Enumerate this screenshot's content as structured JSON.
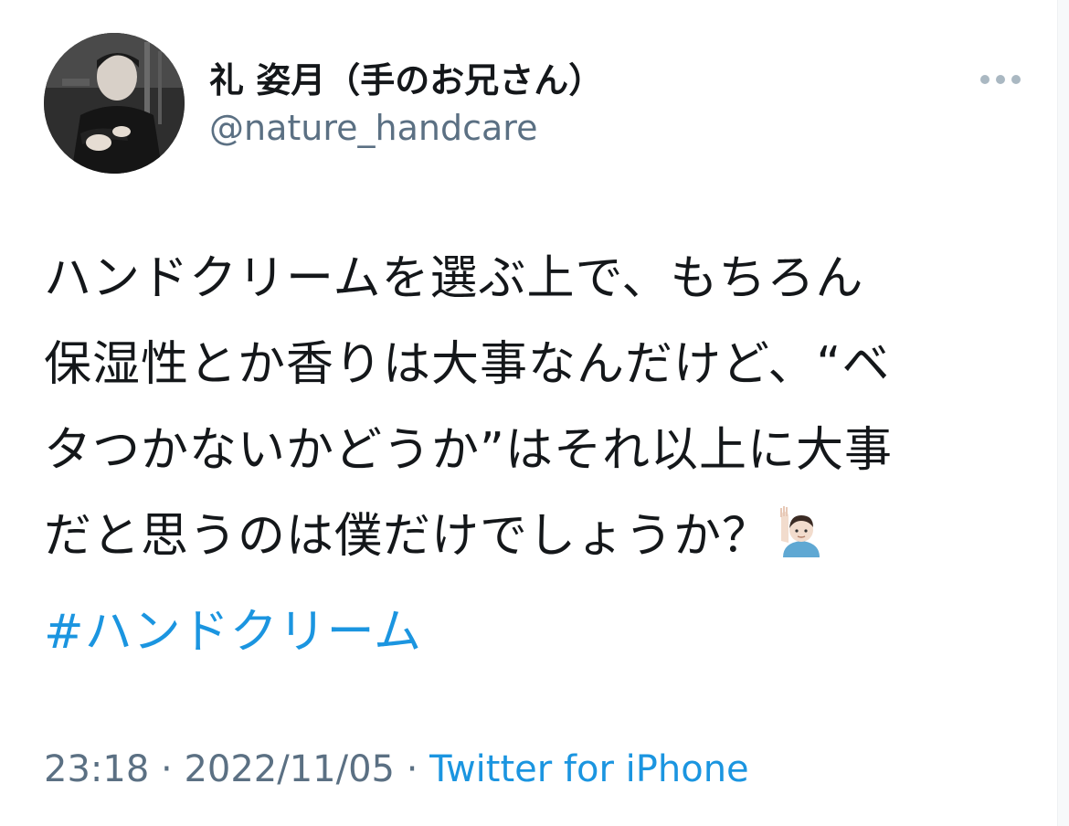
{
  "user": {
    "display_name": "礼 姿月（手のお兄さん）",
    "handle": "@nature_handcare"
  },
  "tweet": {
    "lines": [
      "ハンドクリームを選ぶ上で、もちろん",
      "保湿性とか香りは大事なんだけど、“ベ",
      "タつかないかどうか”はそれ以上に大事",
      "だと思うのは僕だけでしょうか？"
    ],
    "emoji": "raising-hand-emoji",
    "hashtag": "#ハンドクリーム"
  },
  "meta": {
    "time": "23:18",
    "separator": "·",
    "date": "2022/11/05",
    "source": "Twitter for iPhone"
  },
  "colors": {
    "link": "#1b95e0",
    "secondary": "#5b7083",
    "text": "#14171a"
  },
  "icons": {
    "more": "more-horizontal-icon",
    "avatar": "profile-avatar"
  }
}
